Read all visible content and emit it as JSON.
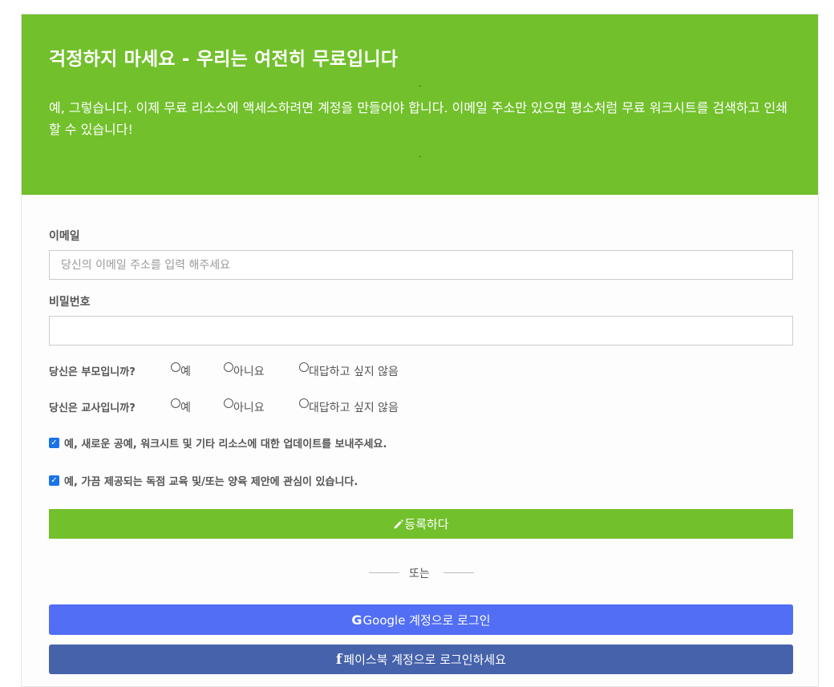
{
  "banner": {
    "title": "걱정하지 마세요 - 우리는 여전히 무료입니다",
    "marker_top": "-",
    "text": "예, 그렇습니다. 이제 무료 리소스에 액세스하려면 계정을 만들어야 합니다. 이메일 주소만 있으면 평소처럼 무료 워크시트를 검색하고 인쇄할 수 있습니다!",
    "marker_bottom": "-"
  },
  "form": {
    "email_label": "이메일",
    "email_placeholder": "당신의 이메일 주소를 입력 해주세요",
    "email_value": "",
    "password_label": "비밀번호",
    "password_value": "",
    "parent_question": {
      "label": "당신은 부모입니까?",
      "options": [
        "예",
        "아니요",
        "대답하고 싶지 않음"
      ]
    },
    "teacher_question": {
      "label": "당신은 교사입니까?",
      "options": [
        "예",
        "아니요",
        "대답하고 싶지 않음"
      ]
    },
    "updates_checkbox": {
      "label": "예, 새로운 공예, 워크시트 및 기타 리소스에 대한 업데이트를 보내주세요.",
      "checked": true
    },
    "offers_checkbox": {
      "label": "예, 가끔 제공되는 독점 교육 및/또는 양육 제안에 관심이 있습니다.",
      "checked": true
    },
    "register_button": "등록하다",
    "divider_text": "또는",
    "google_button": "Google 계정으로 로그인",
    "facebook_button": "페이스북 계정으로 로그인하세요"
  },
  "colors": {
    "brand_green": "#72c02c",
    "google_blue": "#516ef5",
    "facebook_blue": "#4562ab",
    "checkbox_blue": "#1a73e8"
  },
  "icons": {
    "register": "pencil-icon",
    "google": "google-g-icon",
    "facebook": "facebook-f-icon",
    "checkbox": "checkmark-icon"
  }
}
